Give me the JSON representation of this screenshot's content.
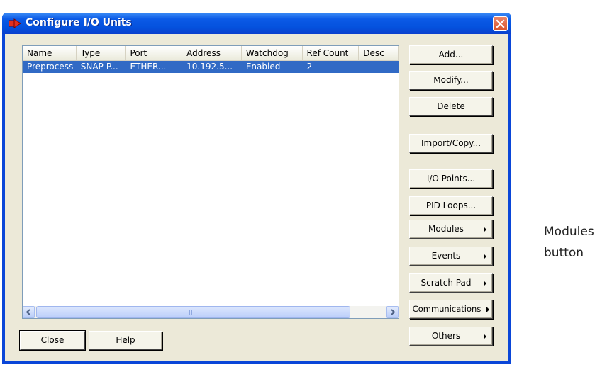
{
  "window": {
    "title": "Configure I/O Units"
  },
  "table": {
    "columns": [
      "Name",
      "Type",
      "Port",
      "Address",
      "Watchdog",
      "Ref Count",
      "Desc"
    ],
    "rows": [
      [
        "Preprocess",
        "SNAP-P...",
        "ETHER...",
        "10.192.5...",
        "Enabled",
        "2",
        ""
      ]
    ]
  },
  "buttons": {
    "add": "Add...",
    "modify": "Modify...",
    "delete": "Delete",
    "import_copy": "Import/Copy...",
    "io_points": "I/O Points...",
    "pid_loops": "PID Loops...",
    "modules": "Modules",
    "events": "Events",
    "scratch_pad": "Scratch Pad",
    "communications": "Communications",
    "others": "Others",
    "close": "Close",
    "help": "Help"
  },
  "callout": {
    "line1": "Modules",
    "line2": "button"
  },
  "icons": [
    "app-icon",
    "close-icon",
    "scroll-left-icon",
    "scroll-right-icon",
    "submenu-arrow-icon"
  ],
  "colors": {
    "title_bar": "#0a54e0",
    "selection": "#316ac5",
    "dialog_bg": "#ece9d8"
  }
}
